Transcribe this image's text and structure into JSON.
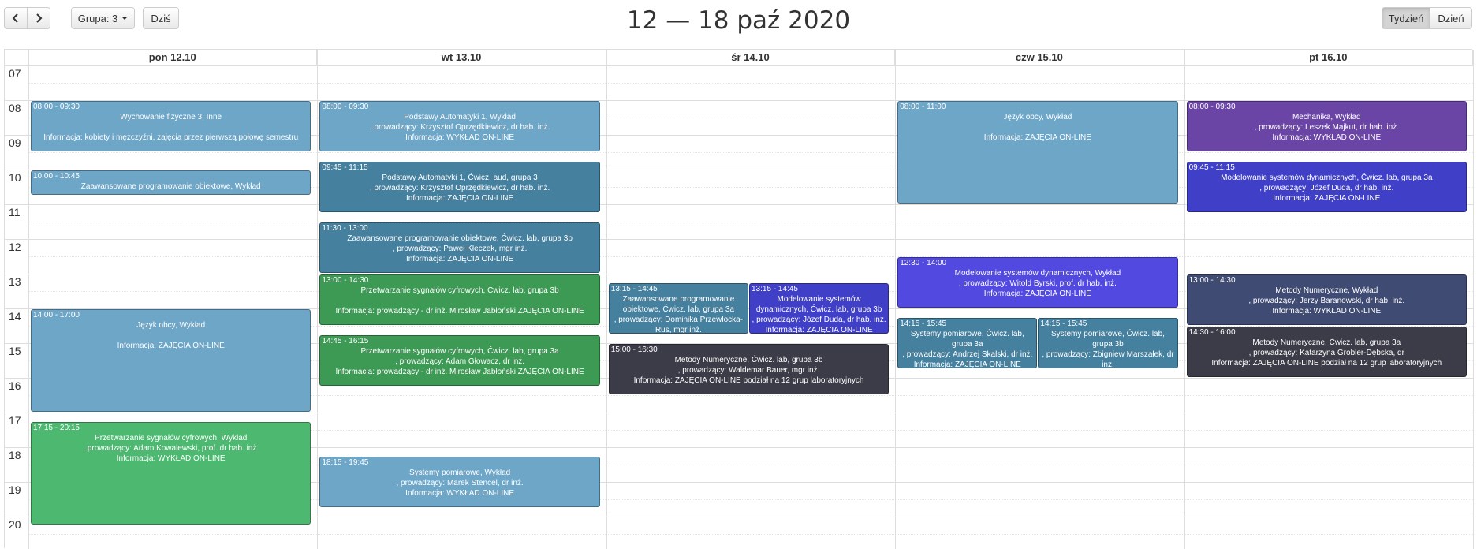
{
  "toolbar": {
    "prev_icon": "chevron-left-icon",
    "next_icon": "chevron-right-icon",
    "group_label": "Grupa: 3",
    "today_label": "Dziś",
    "week_label": "Tydzień",
    "day_label": "Dzień"
  },
  "title": "12 — 18 paź 2020",
  "days": [
    "pon 12.10",
    "wt 13.10",
    "śr 14.10",
    "czw 15.10",
    "pt 16.10"
  ],
  "hours": [
    "07",
    "08",
    "09",
    "10",
    "11",
    "12",
    "13",
    "14",
    "15",
    "16",
    "17",
    "18",
    "19",
    "20"
  ],
  "colors": {
    "lightblue": "#6ea6c8",
    "steelblue": "#46809f",
    "green": "#3d9a55",
    "lightgreen": "#4cb870",
    "purple": "#6a45a6",
    "indigo": "#3f3fc8",
    "violet": "#5149e0",
    "slate": "#3f4b72",
    "dark": "#3c3c48"
  },
  "events": [
    {
      "day": 0,
      "time": "08:00 - 09:30",
      "desc": "Wychowanie fizyczne 3, Inne\n\nInformacja: kobiety i mężczyźni, zajęcia przez pierwszą połowę semestru",
      "color": "lightblue"
    },
    {
      "day": 0,
      "time": "10:00 - 10:45",
      "desc": "Zaawansowane programowanie obiektowe, Wykład",
      "color": "lightblue"
    },
    {
      "day": 0,
      "time": "14:00 - 17:00",
      "desc": "Język obcy, Wykład\n\nInformacja: ZAJĘCIA ON-LINE",
      "color": "lightblue"
    },
    {
      "day": 0,
      "time": "17:15 - 20:15",
      "desc": "Przetwarzanie sygnałów cyfrowych, Wykład\n, prowadzący: Adam Kowalewski, prof. dr hab. inż.\nInformacja: WYKŁAD ON-LINE",
      "color": "lightgreen"
    },
    {
      "day": 1,
      "time": "08:00 - 09:30",
      "desc": "Podstawy Automatyki 1, Wykład\n, prowadzący: Krzysztof Oprzędkiewicz, dr hab. inż.\nInformacja: WYKŁAD ON-LINE",
      "color": "lightblue"
    },
    {
      "day": 1,
      "time": "09:45 - 11:15",
      "desc": "Podstawy Automatyki 1, Ćwicz. aud, grupa 3\n, prowadzący: Krzysztof Oprzędkiewicz, dr hab. inż.\nInformacja: ZAJĘCIA ON-LINE",
      "color": "steelblue"
    },
    {
      "day": 1,
      "time": "11:30 - 13:00",
      "desc": "Zaawansowane programowanie obiektowe, Ćwicz. lab, grupa 3b\n, prowadzący: Paweł Kłeczek, mgr inż.\nInformacja: ZAJĘCIA ON-LINE",
      "color": "steelblue"
    },
    {
      "day": 1,
      "time": "13:00 - 14:30",
      "desc": "Przetwarzanie sygnałów cyfrowych, Ćwicz. lab, grupa 3b\n\nInformacja: prowadzący - dr inż. Mirosław Jabłoński ZAJĘCIA ON-LINE",
      "color": "green"
    },
    {
      "day": 1,
      "time": "14:45 - 16:15",
      "desc": "Przetwarzanie sygnałów cyfrowych, Ćwicz. lab, grupa 3a\n, prowadzący: Adam Głowacz, dr inż.\nInformacja: prowadzący - dr inż. Mirosław Jabłoński ZAJĘCIA ON-LINE",
      "color": "green"
    },
    {
      "day": 1,
      "time": "18:15 - 19:45",
      "desc": "Systemy pomiarowe, Wykład\n, prowadzący: Marek Stencel, dr inż.\nInformacja: WYKŁAD ON-LINE",
      "color": "lightblue"
    },
    {
      "day": 2,
      "time": "13:15 - 14:45",
      "desc": "Zaawansowane programowanie obiektowe, Ćwicz. lab, grupa 3a\n, prowadzący: Dominika Przewłocka-Rus, mgr inż.",
      "color": "steelblue",
      "col": 0,
      "cols": 2
    },
    {
      "day": 2,
      "time": "13:15 - 14:45",
      "desc": "Modelowanie systemów dynamicznych, Ćwicz. lab, grupa 3b\n, prowadzący: Józef Duda, dr hab. inż.\nInformacja: ZAJĘCIA ON-LINE",
      "color": "indigo",
      "col": 1,
      "cols": 2
    },
    {
      "day": 2,
      "time": "15:00 - 16:30",
      "desc": "Metody Numeryczne, Ćwicz. lab, grupa 3b\n, prowadzący: Waldemar Bauer, mgr inż.\nInformacja: ZAJĘCIA ON-LINE podział na 12 grup laboratoryjnych",
      "color": "dark"
    },
    {
      "day": 3,
      "time": "08:00 - 11:00",
      "desc": "Język obcy, Wykład\n\nInformacja: ZAJĘCIA ON-LINE",
      "color": "lightblue"
    },
    {
      "day": 3,
      "time": "12:30 - 14:00",
      "desc": "Modelowanie systemów dynamicznych, Wykład\n, prowadzący: Witold Byrski, prof. dr hab. inż.\nInformacja: ZAJĘCIA ON-LINE",
      "color": "violet"
    },
    {
      "day": 3,
      "time": "14:15 - 15:45",
      "desc": "Systemy pomiarowe, Ćwicz. lab, grupa 3a\n, prowadzący: Andrzej Skalski, dr inż.\nInformacja: ZAJĘCIA ON-LINE",
      "color": "steelblue",
      "col": 0,
      "cols": 2
    },
    {
      "day": 3,
      "time": "14:15 - 15:45",
      "desc": "Systemy pomiarowe, Ćwicz. lab, grupa 3b\n, prowadzący: Zbigniew Marszałek, dr inż.\nInformacja: ZAJĘCIA ON-LINE",
      "color": "steelblue",
      "col": 1,
      "cols": 2
    },
    {
      "day": 4,
      "time": "08:00 - 09:30",
      "desc": "Mechanika, Wykład\n, prowadzący: Leszek Majkut, dr hab. inż.\nInformacja: WYKŁAD ON-LINE",
      "color": "purple"
    },
    {
      "day": 4,
      "time": "09:45 - 11:15",
      "desc": "Modelowanie systemów dynamicznych, Ćwicz. lab, grupa 3a\n, prowadzący: Józef Duda, dr hab. inż.\nInformacja: ZAJĘCIA ON-LINE",
      "color": "indigo"
    },
    {
      "day": 4,
      "time": "13:00 - 14:30",
      "desc": "Metody Numeryczne, Wykład\n, prowadzący: Jerzy Baranowski, dr hab. inż.\nInformacja: WYKŁAD ON-LINE",
      "color": "slate"
    },
    {
      "day": 4,
      "time": "14:30 - 16:00",
      "desc": "Metody Numeryczne, Ćwicz. lab, grupa 3a\n, prowadzący: Katarzyna Grobler-Dębska, dr\nInformacja: ZAJĘCIA ON-LINE podział na 12 grup laboratoryjnych",
      "color": "dark"
    }
  ]
}
